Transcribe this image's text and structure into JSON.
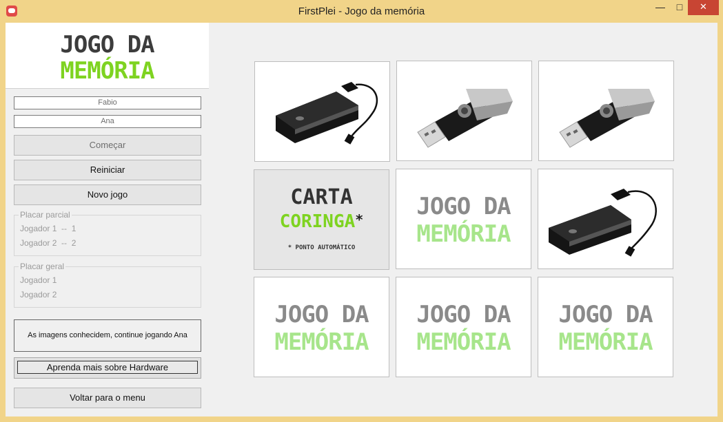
{
  "window": {
    "title": "FirstPlei - Jogo da memória",
    "min_glyph": "—",
    "max_glyph": "□",
    "close_glyph": "✕"
  },
  "sidebar": {
    "logo_line1": "JOGO DA",
    "logo_line2": "MEMÓRIA",
    "player1": "Fabio",
    "player2": "Ana",
    "btn_start": "Começar",
    "btn_restart": "Reiniciar",
    "btn_new_game": "Novo jogo",
    "partial": {
      "title": "Placar parcial",
      "rows": [
        "Jogador 1  --  1",
        "Jogador 2  --  2"
      ]
    },
    "overall": {
      "title": "Placar geral",
      "rows": [
        "Jogador 1",
        "Jogador 2"
      ]
    },
    "message": "As imagens conhecidem, continue jogando Ana",
    "btn_learn": "Aprenda mais sobre Hardware",
    "btn_back": "Voltar para o menu"
  },
  "board": {
    "back_line1": "JOGO DA",
    "back_line2": "MEMÓRIA",
    "joker_line1": "CARTA",
    "joker_line2": "CORINGA",
    "joker_star": "*",
    "joker_line3": "* PONTO AUTOMÁTICO",
    "cards": [
      {
        "state": "face-up",
        "image": "external-hard-drive"
      },
      {
        "state": "face-up",
        "image": "usb-flash-drive"
      },
      {
        "state": "face-up",
        "image": "usb-flash-drive"
      },
      {
        "state": "joker",
        "image": "carta-coringa"
      },
      {
        "state": "face-down",
        "image": "card-back"
      },
      {
        "state": "face-up",
        "image": "external-hard-drive"
      },
      {
        "state": "face-down",
        "image": "card-back"
      },
      {
        "state": "face-down",
        "image": "card-back"
      },
      {
        "state": "face-down",
        "image": "card-back"
      }
    ]
  },
  "colors": {
    "window_frame": "#f1d489",
    "logo_green": "#7ed321",
    "logo_dark": "#3c3c3c",
    "close_red": "#c84533"
  }
}
